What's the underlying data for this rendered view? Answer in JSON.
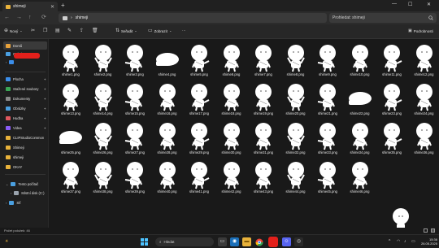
{
  "window": {
    "tab_title": "shimeji",
    "close_glyph": "✕",
    "new_tab_glyph": "+",
    "minimize_glyph": "—",
    "maximize_glyph": "☐",
    "close_window_glyph": "✕"
  },
  "address": {
    "chevron": "›",
    "path": "shimeji",
    "search_placeholder": "Prohledat: shimeji",
    "search_icon": "search-icon"
  },
  "toolbar": {
    "new_label": "Nový",
    "sort_label": "Seřadit",
    "view_label": "Zobrazit",
    "more_label": "···",
    "details_label": "Podrobnosti"
  },
  "sidebar": {
    "home": "Domů",
    "gallery": "Galerie",
    "items": [
      {
        "label": "Plocha",
        "color": "#3b8eea"
      },
      {
        "label": "Stažené soubory",
        "color": "#3aa655"
      },
      {
        "label": "Dokumenty",
        "color": "#8a8a8a"
      },
      {
        "label": "Obrázky",
        "color": "#4a9fe0"
      },
      {
        "label": "Hudba",
        "color": "#e0585f"
      },
      {
        "label": "Videa",
        "color": "#8b5cf6"
      },
      {
        "label": "CLIPStudioCommon",
        "color": "#e8b23b"
      },
      {
        "label": "Shimeji",
        "color": "#e8b23b"
      },
      {
        "label": "shimeji",
        "color": "#e8b23b"
      },
      {
        "label": "OKAY",
        "color": "#e8b23b"
      }
    ],
    "this_pc": "Tento počítač",
    "local_disk": "Místní disk (C:)",
    "network": "Síť"
  },
  "files": [
    "shime1.png",
    "shime2.png",
    "shime3.png",
    "shime4.png",
    "shime5.png",
    "shime6.png",
    "shime7.png",
    "shime8.png",
    "shime9.png",
    "shime10.png",
    "shime11.png",
    "shime12.png",
    "shime13.png",
    "shime14.png",
    "shime15.png",
    "shime16.png",
    "shime17.png",
    "shime18.png",
    "shime19.png",
    "shime20.png",
    "shime21.png",
    "shime22.png",
    "shime23.png",
    "shime24.png",
    "shime25.png",
    "shime26.png",
    "shime27.png",
    "shime28.png",
    "shime29.png",
    "shime30.png",
    "shime31.png",
    "shime32.png",
    "shime33.png",
    "shime34.png",
    "shime35.png",
    "shime36.png",
    "shime37.png",
    "shime38.png",
    "shime39.png",
    "shime40.png",
    "shime41.png",
    "shime42.png",
    "shime43.png",
    "shime44.png",
    "shime45.png",
    "shime46.png"
  ],
  "status": {
    "item_count": "Počet položek: 46"
  },
  "taskbar": {
    "search_label": "Hledat",
    "time": "15:36",
    "date": "26.05.2025",
    "tray_chevron": "^",
    "tray_icons": [
      "wifi-icon",
      "volume-icon",
      "battery-icon"
    ]
  }
}
